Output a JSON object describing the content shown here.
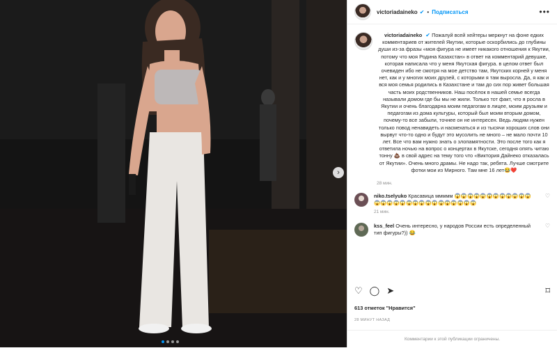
{
  "post": {
    "username": "victoriadaineko",
    "follow_label": "Подписаться",
    "more_label": "•••",
    "next_label": "›",
    "verified_label": "✔",
    "caption": "Пожалуй всей хейтеры меркнут на фоне едких комментариев от жителей Якутии, которые оскорбились до глубины души из-за фразы «моя фигура не имеет никакого отношения к Якутии, потому что моя Родина Казахстан» в ответ на комментарий девушке, которая написала что у меня Якутская фигура. в целом ответ был очевиден ибо не смотря на мое детство там, Якутских корней у меня нет, как и у многих моих друзей, с которыми я там выросла. Да, я как и вся моя семья родились в Казахстане и там до сих пор живет большая часть моих родственников. Наш посёлок в нашей семье всегда называли домом где бы мы не жили. Только тот факт, что я росла в Якутии и очень благодарна моим педагогам в лицее, моим друзьям и педагогам из дома культуры, который был моим вторым домом, почему-то все забыли, точнее он не интересен. Ведь людям нужен только повод ненавидеть и насмехаться и из тысячи хороших слов они вырвут что-то одно и будут это мусолить не много – не мало почти 10 лет. Все что вам нужно знать о злопамятности. Это после того как я ответила ночью на вопрос о концертах в Якутске, сегодня опять читаю тонну 💩 в свой адрес на тему того что «Виктория Дайнеко отказалась от Якутии». Очень много драмы. Не надо так, ребята. Лучше смотрите фотки мои из Мирного. Там мне 16 лет😂❤️",
    "caption_time": "28 мин.",
    "comments": [
      {
        "user": "niko.tselyuko",
        "text": "Красавица ммммм 😱😱😱😱😱😱😱😱😱😱😱😱😱😱😱😱😱😱😱😱😱😱😱😱😱😱😱😱",
        "time": "21 мин."
      },
      {
        "user": "kss_feel",
        "text": "Очень интересно, у народов России есть определенный тип фигуры?)) 😂",
        "time": ""
      }
    ],
    "likes_count": "613",
    "likes_label": "отметок \"Нравится\"",
    "date": "28 МИНУТ НАЗАД",
    "footer": "Комментарии к этой публикации ограничены."
  }
}
